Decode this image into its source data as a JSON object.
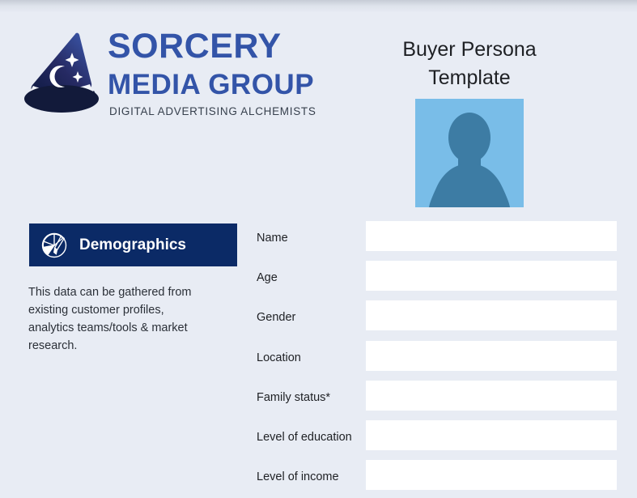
{
  "brand": {
    "logo_icon": "wizard-hat-icon",
    "name_line1": "SORCERY",
    "name_line2": "MEDIA GROUP",
    "tagline": "DIGITAL ADVERTISING ALCHEMISTS",
    "text_color": "#3354a8",
    "tagline_color": "#37404d"
  },
  "header": {
    "title": "Buyer Persona Template",
    "title_line1": "Buyer Persona",
    "title_line2": "Template",
    "avatar_icon": "person-placeholder-avatar",
    "avatar_bg": "#79bde8",
    "avatar_fg": "#3d7ca4"
  },
  "section": {
    "icon": "pie-chart-brush-icon",
    "title": "Demographics",
    "header_bg": "#0b2a66",
    "header_text_color": "#ffffff",
    "description": "This data can be gathered from existing customer profiles, analytics teams/tools & market research."
  },
  "form": {
    "fields": [
      {
        "label": "Name",
        "value": "",
        "placeholder": ""
      },
      {
        "label": "Age",
        "value": "",
        "placeholder": ""
      },
      {
        "label": "Gender",
        "value": "",
        "placeholder": ""
      },
      {
        "label": "Location",
        "value": "",
        "placeholder": ""
      },
      {
        "label": "Family status*",
        "value": "",
        "placeholder": ""
      },
      {
        "label": "Level of education",
        "value": "",
        "placeholder": ""
      },
      {
        "label": "Level of income",
        "value": "",
        "placeholder": ""
      }
    ]
  },
  "theme": {
    "page_bg": "#e8ecf4",
    "input_bg": "#ffffff",
    "text_color": "#1e2024"
  }
}
